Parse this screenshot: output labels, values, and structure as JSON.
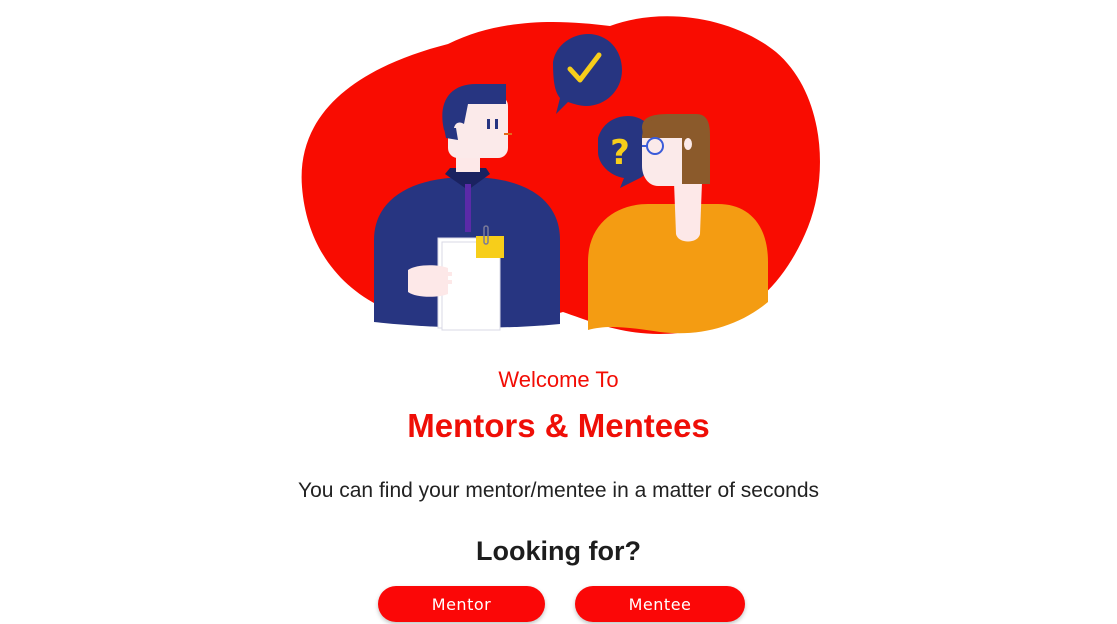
{
  "hero": {
    "illustration": "mentor-mentee-conversation",
    "icons": [
      "checkmark-icon",
      "question-mark-icon"
    ]
  },
  "welcome_text": "Welcome To",
  "app_title": "Mentors & Mentees",
  "tagline": "You can find your mentor/mentee in a matter of seconds",
  "prompt": "Looking for?",
  "buttons": {
    "mentor": "Mentor",
    "mentee": "Mentee"
  },
  "colors": {
    "brand_red": "#f90c01",
    "button_red": "#fb0707",
    "navy": "#273581",
    "orange": "#f49c12",
    "brown": "#8b5a2b",
    "yellow": "#f7ce1a",
    "text_dark": "#1d1d1d"
  }
}
